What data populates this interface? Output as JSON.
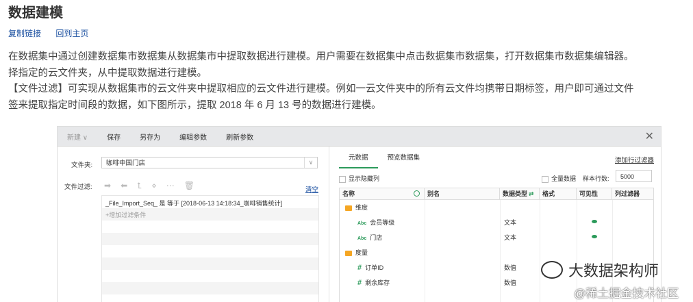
{
  "page": {
    "title": "数据建模",
    "links": [
      "复制链接",
      "回到主页"
    ],
    "paragraph_lines": [
      "在数据集中通过创建数据集市数据集从数据集市中提取数据进行建模。用户需要在数据集中点击数据集市数据集，打开数据集市数据集编辑器。",
      "择指定的云文件夹，从中提取数据进行建模。",
      "【文件过滤】可实现从数据集市的云文件夹中提取相应的云文件进行建模。例如一云文件夹中的所有云文件均携带日期标签，用户即可通过文件",
      "签来提取指定时间段的数据，如下图所示，提取 2018 年 6 月 13 号的数据进行建模。"
    ]
  },
  "editor": {
    "toolbar": {
      "new_label": "新建 ∨",
      "save_label": "保存",
      "save_as_label": "另存为",
      "edit_params_label": "编辑参数",
      "refresh_params_label": "刷新参数",
      "close_glyph": "✕"
    },
    "folder_label": "文件夹:",
    "folder_value": "咖啡中国门店",
    "filter_label": "文件过滤:",
    "filter_icons": [
      "arrow-right-icon",
      "arrow-left-icon",
      "indent-icon",
      "group-icon",
      "ungroup-icon",
      "trash-icon"
    ],
    "clear_label": "清空",
    "filter_condition": "_File_Import_Seq_ 是 等于 [2018-06-13 14:18:34_咖啡销售统计]",
    "add_condition": "+增加过滤条件",
    "tabs": [
      "元数据",
      "预览数据集"
    ],
    "add_row_filter": "添加行过滤器",
    "show_hidden": "显示隐藏列",
    "all_data": "全量数据",
    "sample_rows_label": "样本行数:",
    "sample_rows_value": "5000",
    "grid_headers": [
      "名称",
      "别名",
      "数据类型",
      "格式",
      "可见性",
      "列过滤器"
    ],
    "rows": [
      {
        "kind": "folder",
        "name": "维度",
        "type": ""
      },
      {
        "kind": "text",
        "name": "会员等级",
        "type": "文本",
        "visible": true
      },
      {
        "kind": "text",
        "name": "门店",
        "type": "文本",
        "visible": true
      },
      {
        "kind": "folder",
        "name": "度量",
        "type": ""
      },
      {
        "kind": "number",
        "name": "订单ID",
        "type": "数值",
        "visible": false
      },
      {
        "kind": "number",
        "name": "剩余库存",
        "type": "数值",
        "visible": false
      }
    ],
    "abc_glyph": "Abc",
    "hash_glyph": "#"
  },
  "watermark": {
    "line1": "大数据架构师",
    "line2": "@稀土掘金技术社区"
  },
  "colors": {
    "accent": "#2b9a5a",
    "link": "#1a4fa0",
    "folder": "#f5a623"
  }
}
